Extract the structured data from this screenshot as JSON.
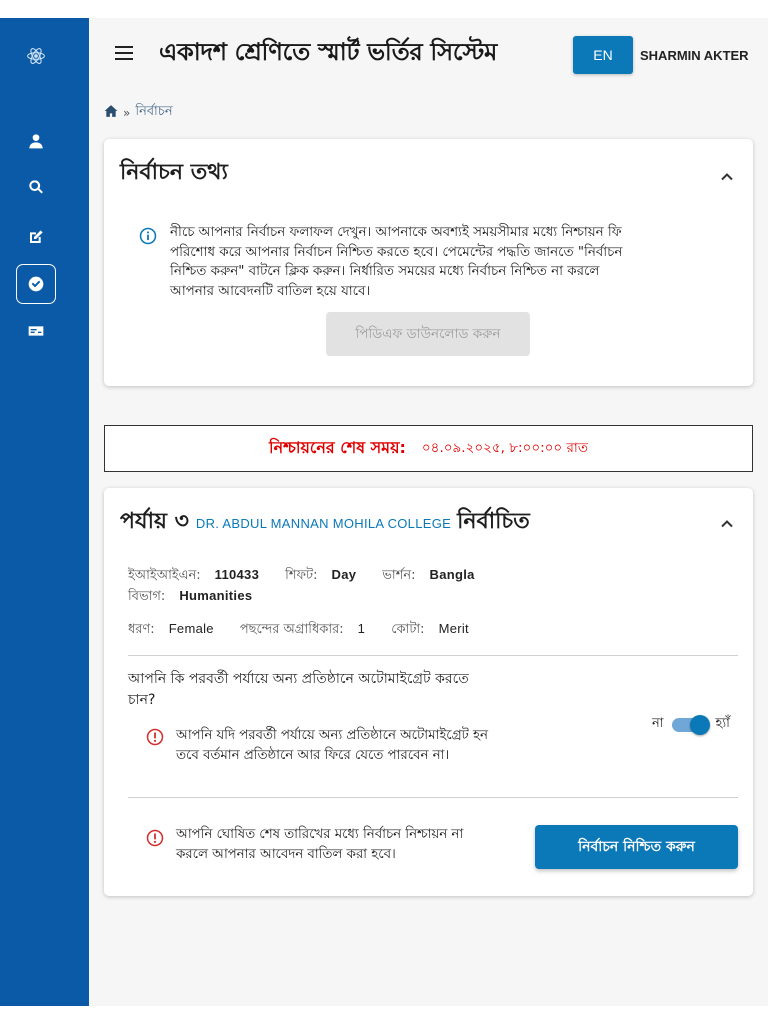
{
  "header": {
    "title": "একাদশ শ্রেণিতে স্মার্ট ভর্তির সিস্টেম",
    "lang_button": "EN",
    "user_name": "SHARMIN AKTER"
  },
  "sidebar": {
    "items": [
      {
        "icon": "user-icon"
      },
      {
        "icon": "search-icon"
      },
      {
        "icon": "edit-icon"
      },
      {
        "icon": "check-circle-icon",
        "active": true
      },
      {
        "icon": "id-card-icon"
      }
    ]
  },
  "breadcrumb": {
    "current": "নির্বাচন"
  },
  "selection_info": {
    "title": "নির্বাচন তথ্য",
    "lines": [
      "নীচে আপনার নির্বাচন ফলাফল দেখুন। আপনাকে অবশ্যই সময়সীমার মধ্যে নিশ্চায়ন ফি",
      "পরিশোধ করে আপনার নির্বাচন নিশ্চিত করতে হবে। পেমেন্টের পদ্ধতি জানতে \"নির্বাচন",
      "নিশ্চিত করুন\" বাটনে ক্লিক করুন। নির্ধারিত সময়ের মধ্যে নির্বাচন নিশ্চিত না করলে",
      "আপনার আবেদনটি বাতিল হয়ে যাবে।"
    ],
    "pdf_button": "পিডিএফ ডাউনলোড করুন"
  },
  "deadline": {
    "label": "নিশ্চায়নের শেষ সময়:",
    "value": "০৪.০৯.২০২৫, ৮:০০:০০ রাত"
  },
  "result": {
    "phase": "পর্যায় ৩",
    "college": "DR. ABDUL MANNAN MOHILA COLLEGE",
    "status": "নির্বাচিত",
    "eiin_label": "ইআইআইএন:",
    "eiin": "110433",
    "shift_label": "শিফট:",
    "shift": "Day",
    "version_label": "ভার্শন:",
    "version": "Bangla",
    "group_label": "বিভাগ:",
    "group": "Humanities",
    "type_label": "ধরণ:",
    "type": "Female",
    "priority_label": "পছন্দের অগ্রাধিকার:",
    "priority": "1",
    "quota_label": "কোটা:",
    "quota": "Merit",
    "question_lines": [
      "আপনি কি পরবর্তী পর্যায়ে অন্য প্রতিষ্ঠানে অটোমাইগ্রেট করতে",
      "চান?"
    ],
    "migrate_warning_lines": [
      "আপনি যদি পরবর্তী পর্যায়ে অন্য প্রতিষ্ঠানে অটোমাইগ্রেট হন",
      "তবে বর্তমান প্রতিষ্ঠানে আর ফিরে যেতে পারবেন না।"
    ],
    "toggle_no": "না",
    "toggle_yes": "হ্যাঁ",
    "toggle_on": true,
    "cancel_warning_lines": [
      "আপনি ঘোষিত শেষ তারিখের মধ্যে নির্বাচন নিশ্চায়ন না",
      "করলে আপনার আবেদন বাতিল করা হবে।"
    ],
    "confirm_button": "নির্বাচন নিশ্চিত করুন"
  },
  "colors": {
    "sidebar": "#0b5aa8",
    "accent": "#0b78b8",
    "deadline_red": "#e00000",
    "warning_red": "#d32f2f"
  }
}
